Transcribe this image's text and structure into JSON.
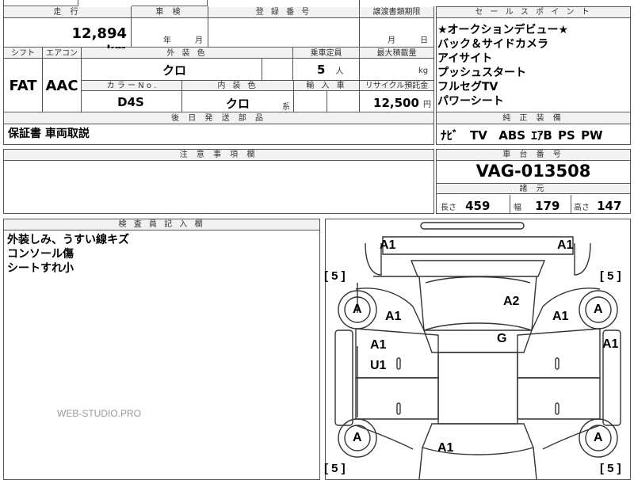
{
  "top": {
    "mileage_label": "走 行",
    "mileage_value": "12,894",
    "mileage_unit": "km",
    "inspection_label": "車 検",
    "inspection_year_unit": "年",
    "inspection_month_unit": "月",
    "registration_label": "登 録 番 号",
    "transfer_label": "譲渡書類期限",
    "transfer_month_unit": "月",
    "transfer_day_unit": "日"
  },
  "row2": {
    "shift_label": "シフト",
    "aircon_label": "エアコン",
    "exterior_color_label": "外 装 色",
    "capacity_label": "乗車定員",
    "max_load_label": "最大積載量",
    "shift_value": "FAT",
    "aircon_value": "AAC",
    "exterior_color_value": "クロ",
    "capacity_value": "5",
    "capacity_unit": "人",
    "load_unit": "kg",
    "color_no_label": "カ ラ ー N o .",
    "interior_color_label": "内 装 色",
    "import_label": "輸 入 車",
    "recycle_label": "リサイクル預託金",
    "color_no_value": "D4S",
    "interior_color_value": "クロ",
    "interior_color_suffix": "系",
    "recycle_value": "12,500",
    "recycle_unit": "円"
  },
  "later_parts": {
    "label": "後 日 発 送 部 品",
    "value": "保証書 車両取説"
  },
  "notes": {
    "label": "注 意 事 項 欄"
  },
  "sales_points": {
    "label": "セ ー ル ス ポ イ ン ト",
    "items": [
      "★オークションデビュー★",
      "バック＆サイドカメラ",
      "アイサイト",
      "プッシュスタート",
      "フルセグTV",
      "パワーシート"
    ]
  },
  "equipment": {
    "label": "純 正 装 備",
    "items": [
      "ﾅﾋﾞ",
      "TV",
      "ABS",
      "ｴｱB",
      "PS",
      "PW"
    ]
  },
  "chassis": {
    "label": "車 台 番 号",
    "value": "VAG-013508"
  },
  "specs": {
    "label": "諸 元",
    "length_label": "長さ",
    "length_value": "459",
    "width_label": "幅",
    "width_value": "179",
    "height_label": "高さ",
    "height_value": "147"
  },
  "inspector": {
    "label": "検 査 員 記 入 欄",
    "lines": [
      "外装しみ、うすい線キズ",
      "コンソール傷",
      "シートすれ小"
    ]
  },
  "watermark": "WEB-STUDIO.PRO",
  "diagram": {
    "marks": {
      "a1_front_left": "A1",
      "a1_front_right": "A1",
      "a2_hood": "A2",
      "a1_fender_left": "A1",
      "a1_fender_right": "A1",
      "g_windshield": "G",
      "a1_door_left": "A1",
      "u1_door_left": "U1",
      "a1_side_right": "A1",
      "a1_rear": "A1"
    },
    "tires": {
      "front_left": "A",
      "front_right": "A",
      "rear_left": "A",
      "rear_right": "A"
    },
    "tread": {
      "top_left": "[ 5 ]",
      "top_right": "[ 5 ]",
      "bottom_left": "[ 5 ]",
      "bottom_right": "[ 5 ]"
    }
  }
}
